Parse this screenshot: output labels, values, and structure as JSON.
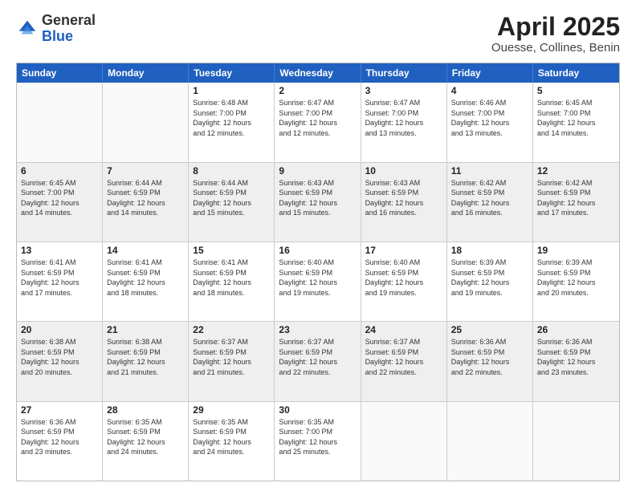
{
  "logo": {
    "general": "General",
    "blue": "Blue"
  },
  "title": "April 2025",
  "subtitle": "Ouesse, Collines, Benin",
  "weekdays": [
    "Sunday",
    "Monday",
    "Tuesday",
    "Wednesday",
    "Thursday",
    "Friday",
    "Saturday"
  ],
  "weeks": [
    [
      {
        "day": "",
        "info": "",
        "empty": true
      },
      {
        "day": "",
        "info": "",
        "empty": true
      },
      {
        "day": "1",
        "info": "Sunrise: 6:48 AM\nSunset: 7:00 PM\nDaylight: 12 hours\nand 12 minutes."
      },
      {
        "day": "2",
        "info": "Sunrise: 6:47 AM\nSunset: 7:00 PM\nDaylight: 12 hours\nand 12 minutes."
      },
      {
        "day": "3",
        "info": "Sunrise: 6:47 AM\nSunset: 7:00 PM\nDaylight: 12 hours\nand 13 minutes."
      },
      {
        "day": "4",
        "info": "Sunrise: 6:46 AM\nSunset: 7:00 PM\nDaylight: 12 hours\nand 13 minutes."
      },
      {
        "day": "5",
        "info": "Sunrise: 6:45 AM\nSunset: 7:00 PM\nDaylight: 12 hours\nand 14 minutes."
      }
    ],
    [
      {
        "day": "6",
        "info": "Sunrise: 6:45 AM\nSunset: 7:00 PM\nDaylight: 12 hours\nand 14 minutes.",
        "shaded": true
      },
      {
        "day": "7",
        "info": "Sunrise: 6:44 AM\nSunset: 6:59 PM\nDaylight: 12 hours\nand 14 minutes.",
        "shaded": true
      },
      {
        "day": "8",
        "info": "Sunrise: 6:44 AM\nSunset: 6:59 PM\nDaylight: 12 hours\nand 15 minutes.",
        "shaded": true
      },
      {
        "day": "9",
        "info": "Sunrise: 6:43 AM\nSunset: 6:59 PM\nDaylight: 12 hours\nand 15 minutes.",
        "shaded": true
      },
      {
        "day": "10",
        "info": "Sunrise: 6:43 AM\nSunset: 6:59 PM\nDaylight: 12 hours\nand 16 minutes.",
        "shaded": true
      },
      {
        "day": "11",
        "info": "Sunrise: 6:42 AM\nSunset: 6:59 PM\nDaylight: 12 hours\nand 16 minutes.",
        "shaded": true
      },
      {
        "day": "12",
        "info": "Sunrise: 6:42 AM\nSunset: 6:59 PM\nDaylight: 12 hours\nand 17 minutes.",
        "shaded": true
      }
    ],
    [
      {
        "day": "13",
        "info": "Sunrise: 6:41 AM\nSunset: 6:59 PM\nDaylight: 12 hours\nand 17 minutes."
      },
      {
        "day": "14",
        "info": "Sunrise: 6:41 AM\nSunset: 6:59 PM\nDaylight: 12 hours\nand 18 minutes."
      },
      {
        "day": "15",
        "info": "Sunrise: 6:41 AM\nSunset: 6:59 PM\nDaylight: 12 hours\nand 18 minutes."
      },
      {
        "day": "16",
        "info": "Sunrise: 6:40 AM\nSunset: 6:59 PM\nDaylight: 12 hours\nand 19 minutes."
      },
      {
        "day": "17",
        "info": "Sunrise: 6:40 AM\nSunset: 6:59 PM\nDaylight: 12 hours\nand 19 minutes."
      },
      {
        "day": "18",
        "info": "Sunrise: 6:39 AM\nSunset: 6:59 PM\nDaylight: 12 hours\nand 19 minutes."
      },
      {
        "day": "19",
        "info": "Sunrise: 6:39 AM\nSunset: 6:59 PM\nDaylight: 12 hours\nand 20 minutes."
      }
    ],
    [
      {
        "day": "20",
        "info": "Sunrise: 6:38 AM\nSunset: 6:59 PM\nDaylight: 12 hours\nand 20 minutes.",
        "shaded": true
      },
      {
        "day": "21",
        "info": "Sunrise: 6:38 AM\nSunset: 6:59 PM\nDaylight: 12 hours\nand 21 minutes.",
        "shaded": true
      },
      {
        "day": "22",
        "info": "Sunrise: 6:37 AM\nSunset: 6:59 PM\nDaylight: 12 hours\nand 21 minutes.",
        "shaded": true
      },
      {
        "day": "23",
        "info": "Sunrise: 6:37 AM\nSunset: 6:59 PM\nDaylight: 12 hours\nand 22 minutes.",
        "shaded": true
      },
      {
        "day": "24",
        "info": "Sunrise: 6:37 AM\nSunset: 6:59 PM\nDaylight: 12 hours\nand 22 minutes.",
        "shaded": true
      },
      {
        "day": "25",
        "info": "Sunrise: 6:36 AM\nSunset: 6:59 PM\nDaylight: 12 hours\nand 22 minutes.",
        "shaded": true
      },
      {
        "day": "26",
        "info": "Sunrise: 6:36 AM\nSunset: 6:59 PM\nDaylight: 12 hours\nand 23 minutes.",
        "shaded": true
      }
    ],
    [
      {
        "day": "27",
        "info": "Sunrise: 6:36 AM\nSunset: 6:59 PM\nDaylight: 12 hours\nand 23 minutes."
      },
      {
        "day": "28",
        "info": "Sunrise: 6:35 AM\nSunset: 6:59 PM\nDaylight: 12 hours\nand 24 minutes."
      },
      {
        "day": "29",
        "info": "Sunrise: 6:35 AM\nSunset: 6:59 PM\nDaylight: 12 hours\nand 24 minutes."
      },
      {
        "day": "30",
        "info": "Sunrise: 6:35 AM\nSunset: 7:00 PM\nDaylight: 12 hours\nand 25 minutes."
      },
      {
        "day": "",
        "info": "",
        "empty": true
      },
      {
        "day": "",
        "info": "",
        "empty": true
      },
      {
        "day": "",
        "info": "",
        "empty": true
      }
    ]
  ]
}
